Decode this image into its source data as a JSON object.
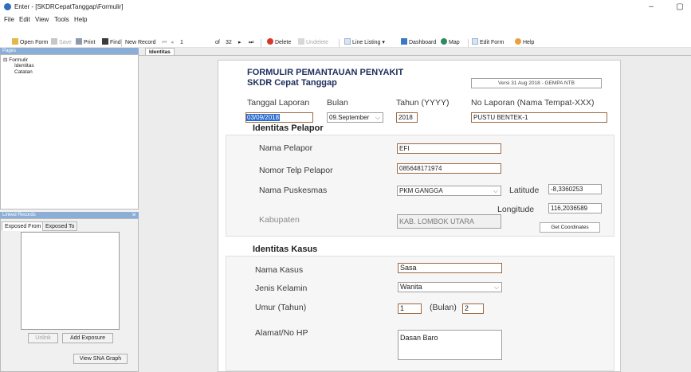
{
  "window": {
    "title": "Enter - [SKDRCepatTanggap\\Formulir]",
    "minimize": "–",
    "restore": "▢"
  },
  "menu": [
    "File",
    "Edit",
    "View",
    "Tools",
    "Help"
  ],
  "toolbar": {
    "open_form": "Open Form",
    "save": "Save",
    "print": "Print",
    "find": "Find",
    "new_record": "New Record",
    "first": "⏮",
    "prev": "◂",
    "record_no": "1",
    "of_label": "of",
    "total": "32",
    "next": "▸",
    "last": "⏭",
    "delete": "Delete",
    "undelete": "Undelete",
    "line_listing": "Line Listing",
    "dashboard": "Dashboard",
    "map": "Map",
    "edit_form": "Edit Form",
    "help": "Help"
  },
  "pages": {
    "header": "Pages",
    "root": "Formulir",
    "items": [
      "Identitas",
      "Catatan"
    ]
  },
  "linked": {
    "header": "Linked Records",
    "pin": "⇲",
    "tabs": [
      "Exposed From",
      "Exposed To"
    ],
    "unlink": "Unlink",
    "add_exposure": "Add Exposure",
    "view_sna": "View SNA Graph"
  },
  "tab": "Identitas",
  "form": {
    "title1": "FORMULIR PEMANTAUAN PENYAKIT",
    "title2": "SKDR Cepat Tanggap",
    "versi": "Versi 31 Aug 2018 - GEMPA NTB",
    "tanggal_label": "Tanggal Laporan",
    "bulan_label": "Bulan",
    "tahun_label": "Tahun (YYYY)",
    "nolap_label": "No Laporan (Nama Tempat-XXX)",
    "tanggal": "03/09/2018",
    "bulan": "09.September",
    "tahun": "2018",
    "nolap": "PUSTU BENTEK-1",
    "pelapor": {
      "section": "Identitas Pelapor",
      "nama_label": "Nama Pelapor",
      "nama": "EFI",
      "telp_label": "Nomor Telp Pelapor",
      "telp": "085648171974",
      "puskesmas_label": "Nama Puskesmas",
      "puskesmas": "PKM GANGGA",
      "lat_label": "Latitude",
      "lat": "-8,3360253",
      "lon_label": "Longitude",
      "lon": "116,2036589",
      "kab_label": "Kabupaten",
      "kab": "KAB. LOMBOK UTARA",
      "coords_btn": "Get Coordinates"
    },
    "kasus": {
      "section": "Identitas Kasus",
      "nama_label": "Nama Kasus",
      "nama": "Sasa",
      "jk_label": "Jenis Kelamin",
      "jk": "Wanita",
      "umur_label": "Umur (Tahun)",
      "umur": "1",
      "bulan_label": "(Bulan)",
      "bulan": "2",
      "alamat_label": "Alamat/No HP",
      "alamat": "Dasan Baro"
    }
  },
  "colors": {
    "accent": "#2a6ccf",
    "border_input": "#9b6a45",
    "header_blue": "#8aaed6",
    "title_navy": "#1c2e5c"
  }
}
